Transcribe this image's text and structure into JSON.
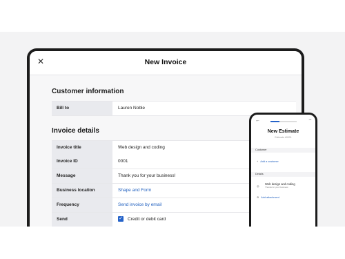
{
  "invoice": {
    "title": "New Invoice",
    "close_glyph": "✕",
    "customer_section": "Customer information",
    "bill_to_label": "Bill to",
    "bill_to_value": "Lauren Noble",
    "details_section": "Invoice details",
    "fields": [
      {
        "label": "Invoice title",
        "value": "Web design and coding",
        "link": false
      },
      {
        "label": "Invoice ID",
        "value": "0001",
        "link": false
      },
      {
        "label": "Message",
        "value": "Thank you for your business!",
        "link": false
      },
      {
        "label": "Business location",
        "value": "Shape and Form",
        "link": true
      },
      {
        "label": "Frequency",
        "value": "Send invoice by email",
        "link": true
      }
    ],
    "send_label": "Send",
    "send_value": "Credit or debit card",
    "send_checked": true
  },
  "estimate": {
    "back_glyph": "←",
    "more_glyph": "···",
    "progress": 0.35,
    "title": "New Estimate",
    "subtitle": "Estimate #0001",
    "customer_section": "Customer",
    "add_customer": "Add a customer",
    "details_section": "Details",
    "item_title": "Web design and coding",
    "item_sub": "Thanks for your business",
    "add_attachment": "Add attachment"
  },
  "colors": {
    "accent": "#2563c9",
    "label_bg": "#e9eaee",
    "link": "#1f5fbf"
  }
}
